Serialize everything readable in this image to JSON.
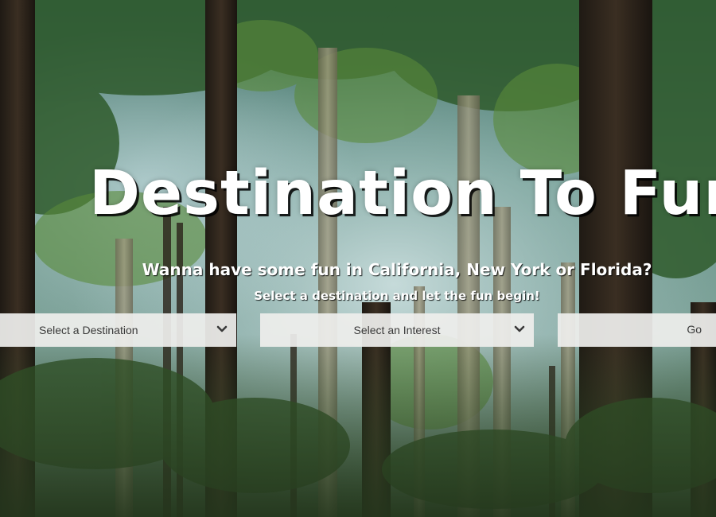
{
  "hero": {
    "title": "Destination To Fun",
    "subtitle": "Wanna have some fun in California, New York or Florida?",
    "caption": "Select a destination and let the fun begin!"
  },
  "search": {
    "destination_select": {
      "selected": "Select a Destination",
      "icon": "chevron-down-icon"
    },
    "interest_select": {
      "selected": "Select an Interest",
      "icon": "chevron-down-icon"
    },
    "go_button": "Go"
  },
  "colors": {
    "title_text": "#ffffff",
    "control_background": "#eeeeec",
    "control_text": "#3a3a3a"
  }
}
